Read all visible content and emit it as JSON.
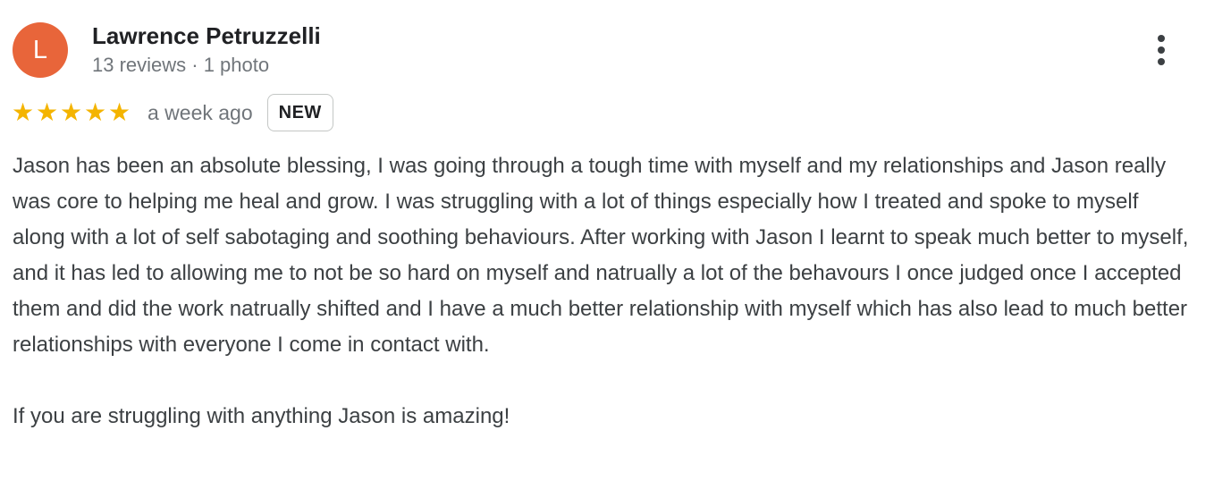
{
  "review": {
    "avatar_initial": "L",
    "reviewer_name": "Lawrence Petruzzelli",
    "reviewer_meta": "13 reviews · 1 photo",
    "rating": 5,
    "rating_max": 5,
    "time_ago": "a week ago",
    "badge": "NEW",
    "paragraphs": [
      "Jason has been an absolute blessing, I was going through a tough time with myself and my relationships and Jason really was core to helping me heal and grow. I was struggling with a lot of things especially how I treated and spoke to myself along with a lot of self sabotaging and soothing behaviours. After working with Jason I learnt to speak much better to myself, and it has led to allowing me to not be so hard on myself and natrually a lot of the behavours I once judged once I accepted them and did the work natrually shifted and I have a much better relationship with myself which has also lead to much better relationships with everyone I come in contact with.",
      "If you are struggling with anything Jason is amazing!"
    ]
  },
  "colors": {
    "avatar_bg": "#e8653a",
    "star": "#f4b400",
    "text": "#3c4043",
    "secondary_text": "#70757a"
  },
  "icons": {
    "more": "more-vertical-icon",
    "star": "star-icon"
  }
}
